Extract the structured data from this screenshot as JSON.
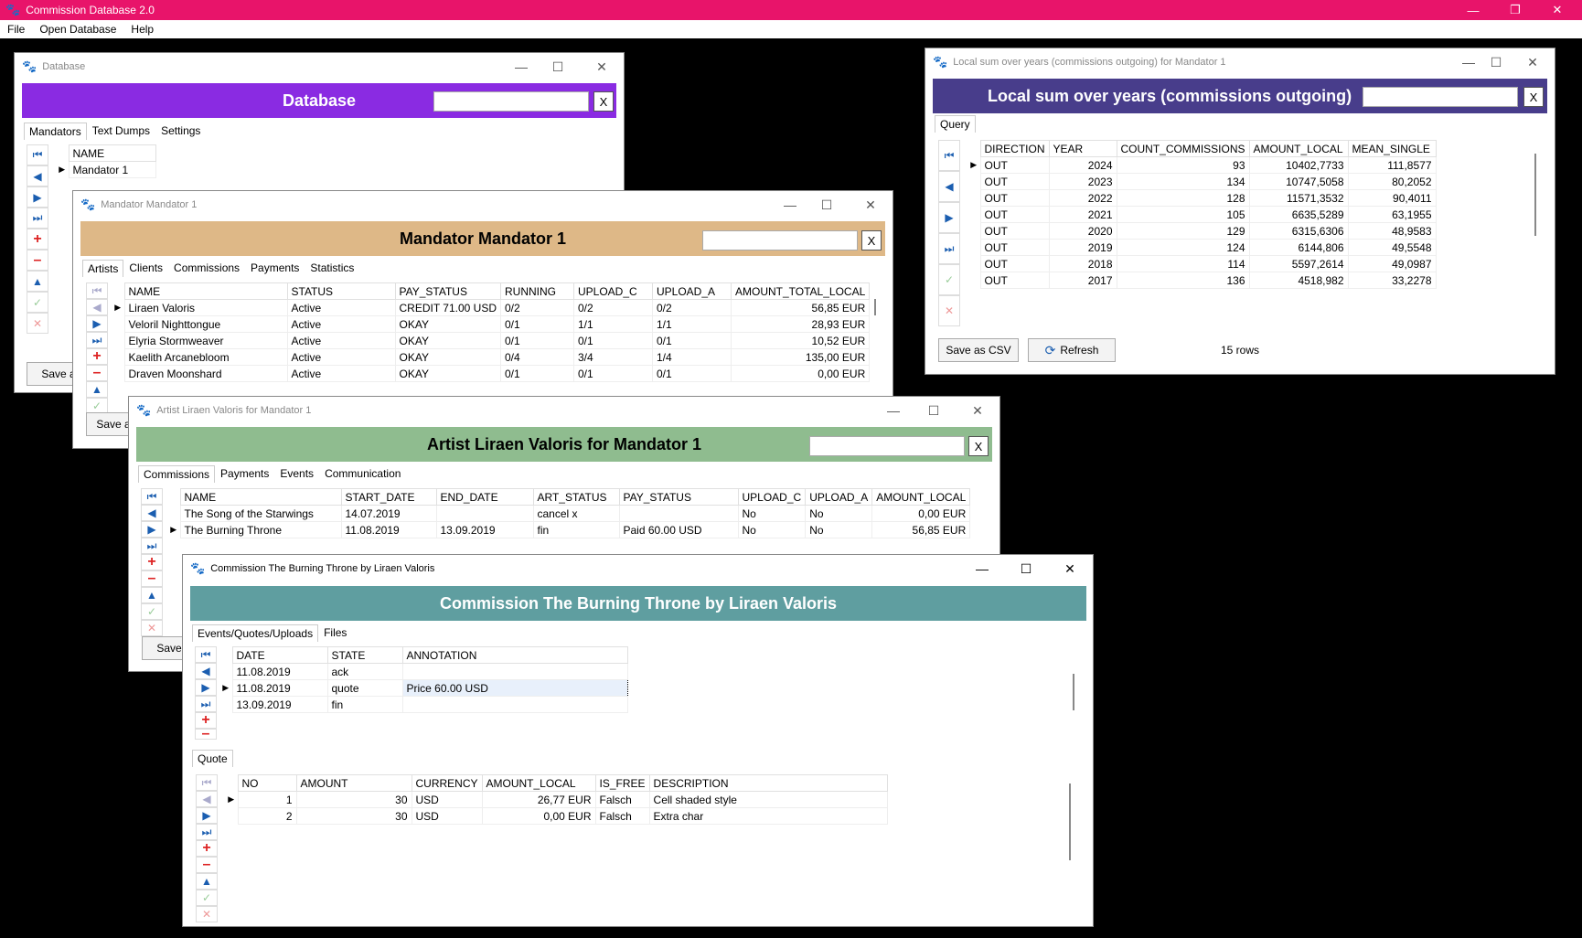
{
  "app": {
    "title": "Commission Database 2.0",
    "menu": [
      "File",
      "Open Database",
      "Help"
    ]
  },
  "db_window": {
    "title": "Database",
    "banner": "Database",
    "search_clear": "X",
    "tabs": [
      "Mandators",
      "Text Dumps",
      "Settings"
    ],
    "columns": [
      "NAME"
    ],
    "rows": [
      [
        "Mandator 1"
      ]
    ],
    "save_label": "Save a"
  },
  "mandator_window": {
    "title": "Mandator Mandator 1",
    "banner": "Mandator Mandator 1",
    "search_clear": "X",
    "tabs": [
      "Artists",
      "Clients",
      "Commissions",
      "Payments",
      "Statistics"
    ],
    "columns": [
      "NAME",
      "STATUS",
      "PAY_STATUS",
      "RUNNING",
      "UPLOAD_C",
      "UPLOAD_A",
      "AMOUNT_TOTAL_LOCAL"
    ],
    "rows": [
      [
        "Liraen Valoris",
        "Active",
        "CREDIT 71.00 USD",
        "0/2",
        "0/2",
        "0/2",
        "56,85 EUR"
      ],
      [
        "Veloril Nighttongue",
        "Active",
        "OKAY",
        "0/1",
        "1/1",
        "1/1",
        "28,93 EUR"
      ],
      [
        "Elyria Stormweaver",
        "Active",
        "OKAY",
        "0/1",
        "0/1",
        "0/1",
        "10,52 EUR"
      ],
      [
        "Kaelith Arcanebloom",
        "Active",
        "OKAY",
        "0/4",
        "3/4",
        "1/4",
        "135,00 EUR"
      ],
      [
        "Draven Moonshard",
        "Active",
        "OKAY",
        "0/1",
        "0/1",
        "0/1",
        "0,00 EUR"
      ]
    ],
    "save_label": "Save a"
  },
  "artist_window": {
    "title": "Artist Liraen Valoris for Mandator 1",
    "banner": "Artist Liraen Valoris for Mandator 1",
    "search_clear": "X",
    "tabs": [
      "Commissions",
      "Payments",
      "Events",
      "Communication"
    ],
    "columns": [
      "NAME",
      "START_DATE",
      "END_DATE",
      "ART_STATUS",
      "PAY_STATUS",
      "UPLOAD_C",
      "UPLOAD_A",
      "AMOUNT_LOCAL"
    ],
    "rows": [
      [
        "The Song of the Starwings",
        "14.07.2019",
        "",
        "cancel x",
        "",
        "No",
        "No",
        "0,00 EUR"
      ],
      [
        "The Burning Throne",
        "11.08.2019",
        "13.09.2019",
        "fin",
        "Paid 60.00 USD",
        "No",
        "No",
        "56,85 EUR"
      ]
    ],
    "save_label": "Save"
  },
  "commission_window": {
    "title": "Commission The Burning Throne by Liraen Valoris",
    "banner": "Commission The Burning Throne by Liraen Valoris",
    "tabs": [
      "Events/Quotes/Uploads",
      "Files"
    ],
    "event_columns": [
      "DATE",
      "STATE",
      "ANNOTATION"
    ],
    "event_rows": [
      [
        "11.08.2019",
        "ack",
        ""
      ],
      [
        "11.08.2019",
        "quote",
        "Price 60.00 USD"
      ],
      [
        "13.09.2019",
        "fin",
        ""
      ]
    ],
    "quote_tab": "Quote",
    "quote_columns": [
      "NO",
      "AMOUNT",
      "CURRENCY",
      "AMOUNT_LOCAL",
      "IS_FREE",
      "DESCRIPTION"
    ],
    "quote_rows": [
      [
        "1",
        "30",
        "USD",
        "26,77 EUR",
        "Falsch",
        "Cell shaded style"
      ],
      [
        "2",
        "30",
        "USD",
        "0,00 EUR",
        "Falsch",
        "Extra char"
      ]
    ]
  },
  "sum_window": {
    "title": "Local sum over years (commissions outgoing) for Mandator 1",
    "banner": "Local sum over years (commissions outgoing)",
    "search_clear": "X",
    "tabs": [
      "Query"
    ],
    "columns": [
      "DIRECTION",
      "YEAR",
      "COUNT_COMMISSIONS",
      "AMOUNT_LOCAL",
      "MEAN_SINGLE"
    ],
    "rows": [
      [
        "OUT",
        "2024",
        "93",
        "10402,7733",
        "111,8577"
      ],
      [
        "OUT",
        "2023",
        "134",
        "10747,5058",
        "80,2052"
      ],
      [
        "OUT",
        "2022",
        "128",
        "11571,3532",
        "90,4011"
      ],
      [
        "OUT",
        "2021",
        "105",
        "6635,5289",
        "63,1955"
      ],
      [
        "OUT",
        "2020",
        "129",
        "6315,6306",
        "48,9583"
      ],
      [
        "OUT",
        "2019",
        "124",
        "6144,806",
        "49,5548"
      ],
      [
        "OUT",
        "2018",
        "114",
        "5597,2614",
        "49,0987"
      ],
      [
        "OUT",
        "2017",
        "136",
        "4518,982",
        "33,2278"
      ]
    ],
    "save_csv": "Save as CSV",
    "refresh": "Refresh",
    "row_count": "15 rows"
  },
  "colors": {
    "app_titlebar": "#e8146a",
    "database": "#8a2be2",
    "mandator": "#deb887",
    "artist": "#8fbc8f",
    "commission": "#5f9ea0",
    "sum": "#483d8b"
  }
}
